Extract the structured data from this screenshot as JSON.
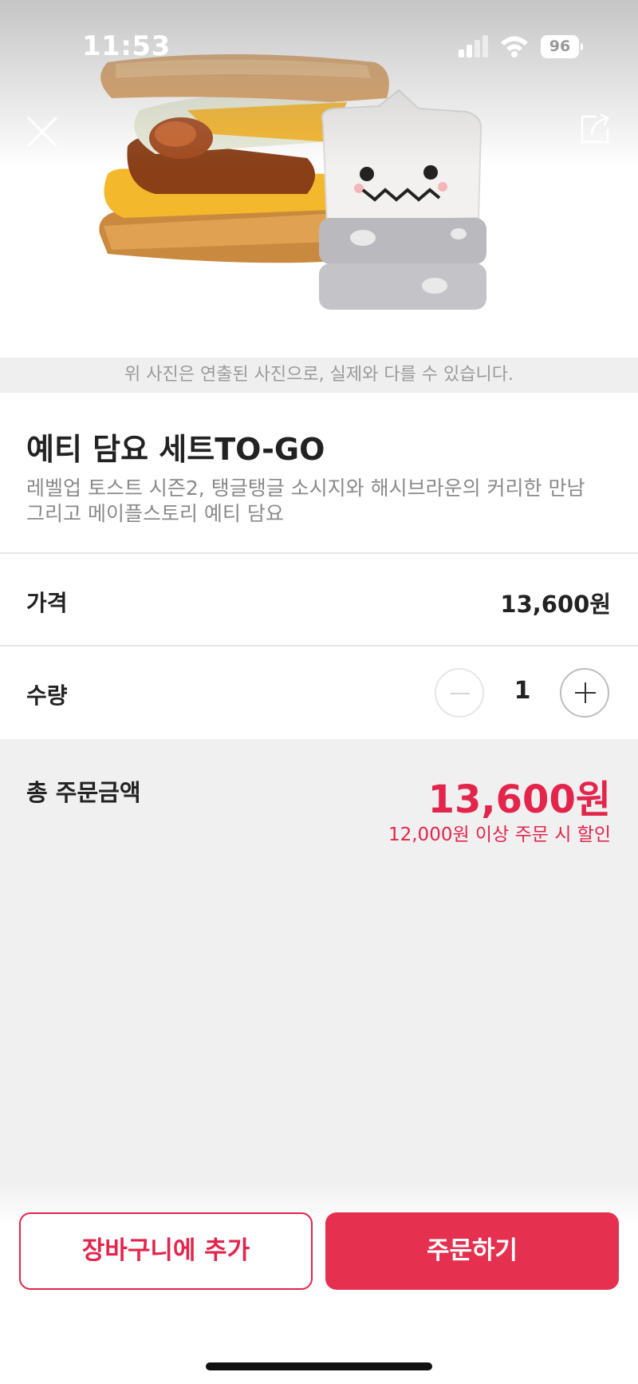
{
  "status_bar": {
    "time": "11:53",
    "battery": "96",
    "icons": [
      "signal-icon",
      "wifi-icon",
      "battery-icon"
    ]
  },
  "header": {
    "close_icon": "close-icon",
    "share_icon": "share-icon"
  },
  "photo_note": "위 사진은 연출된 사진으로, 실제와 다를 수 있습니다.",
  "product": {
    "title": "예티 담요 세트TO-GO",
    "description_line1": "레벨업 토스트 시즌2, 탱글탱글 소시지와 해시브라운의 커리한 만남",
    "description_line2": "그리고 메이플스토리 예티 담요"
  },
  "price_row": {
    "label": "가격",
    "value": "13,600원"
  },
  "quantity_row": {
    "label": "수량",
    "value": "1",
    "minus_icon": "minus-icon",
    "plus_icon": "plus-icon"
  },
  "total": {
    "label": "총 주문금액",
    "value": "13,600원",
    "note": "12,000원 이상 주문 시 할인"
  },
  "actions": {
    "cart_label": "장바구니에 추가",
    "order_label": "주문하기"
  },
  "colors": {
    "accent": "#e3254c",
    "button_fill": "#e5304f",
    "background": "#f0f0f0"
  }
}
